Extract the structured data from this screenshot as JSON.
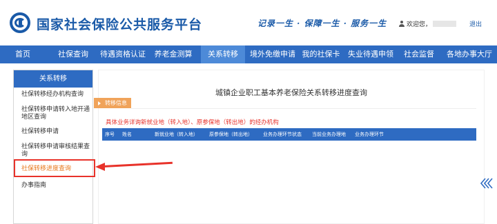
{
  "header": {
    "site_title": "国家社会保险公共服务平台",
    "slogan": "记录一生 · 保障一生 · 服务一生",
    "welcome": "欢迎您，",
    "logout": "退出"
  },
  "nav": {
    "items": [
      "首页",
      "社保查询",
      "待遇资格认证",
      "养老金测算",
      "关系转移",
      "境外免缴申请",
      "我的社保卡",
      "失业待遇申领",
      "社会监督",
      "各地办事大厅"
    ],
    "active_index": 4
  },
  "sidebar": {
    "title": "关系转移",
    "items": [
      "社保转移经办机构查询",
      "社保转移申请转入地开通地区查询",
      "社保转移申请",
      "社保转移申请审核结果查询",
      "社保转移进度查询",
      "办事指南"
    ],
    "active_index": 4
  },
  "main": {
    "title": "城镇企业职工基本养老保险关系转移进度查询",
    "tab_label": "转移信息",
    "notice": "具体业务详询新就业地（转入地）、原参保地（转出地）的经办机构",
    "table_columns": [
      "序号",
      "姓名",
      "新就业地（转入地）",
      "原参保地（转出地）",
      "业务办理环节状态",
      "当前业务办理地",
      "业务办理环节"
    ]
  },
  "colors": {
    "brand_blue": "#1a5aa8",
    "nav_blue": "#2e6bc2",
    "active_orange": "#e8781c",
    "alert_red": "#e8322a"
  }
}
